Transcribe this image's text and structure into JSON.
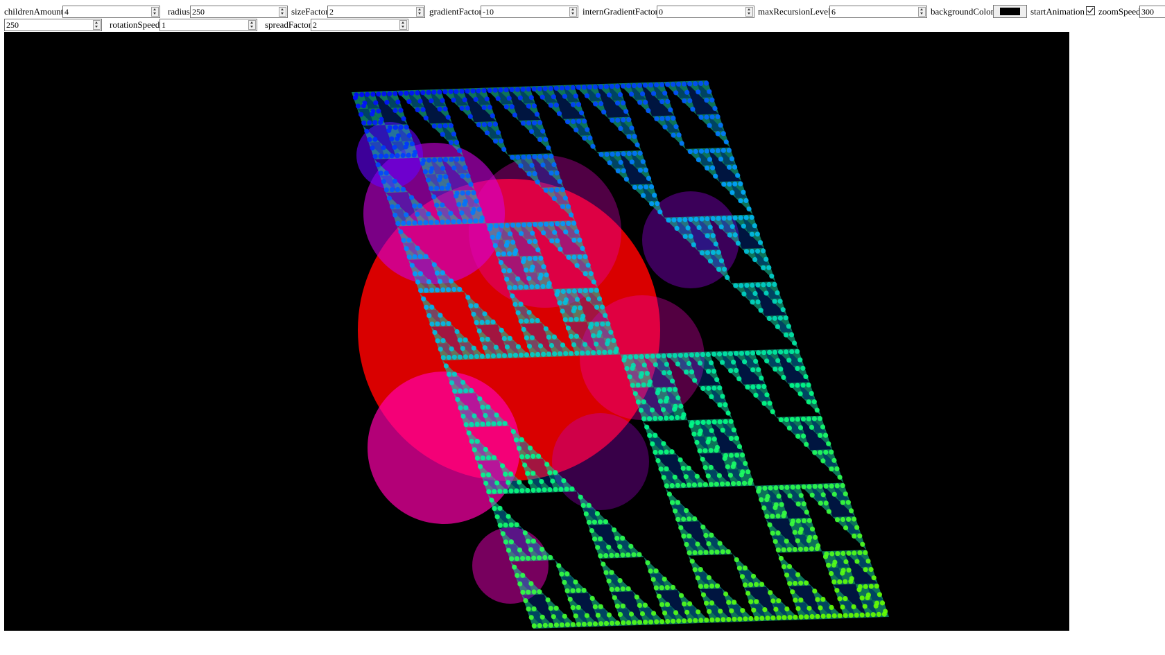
{
  "controls": {
    "children_amount": {
      "label": "childrenAmount",
      "value": "4"
    },
    "radius": {
      "label": "radius",
      "value": "250"
    },
    "size_factor": {
      "label": "sizeFactor",
      "value": "2"
    },
    "gradient_factor": {
      "label": "gradientFactor",
      "value": "-10"
    },
    "intern_gradient_factor": {
      "label": "internGradientFactor",
      "value": "0"
    },
    "max_recursion_level": {
      "label": "maxRecursionLevel",
      "value": "6"
    },
    "background_color": {
      "label": "backgroundColor",
      "value": "#000000"
    },
    "start_animation": {
      "label": "startAnimation",
      "checked": true
    },
    "zoom_speed": {
      "label": "zoomSpeed",
      "value": "300"
    },
    "zoom_speed_2": {
      "value": "250"
    },
    "rotation_speed": {
      "label": "rotationSpeed",
      "value": "1"
    },
    "spread_factor": {
      "label": "spreadFactor",
      "value": "2"
    }
  },
  "canvas": {
    "background": "#000000",
    "palette": [
      "#ff0000",
      "#ff00aa",
      "#aa00ff",
      "#0000ff",
      "#00aaff",
      "#00ff88",
      "#66ff00"
    ]
  }
}
